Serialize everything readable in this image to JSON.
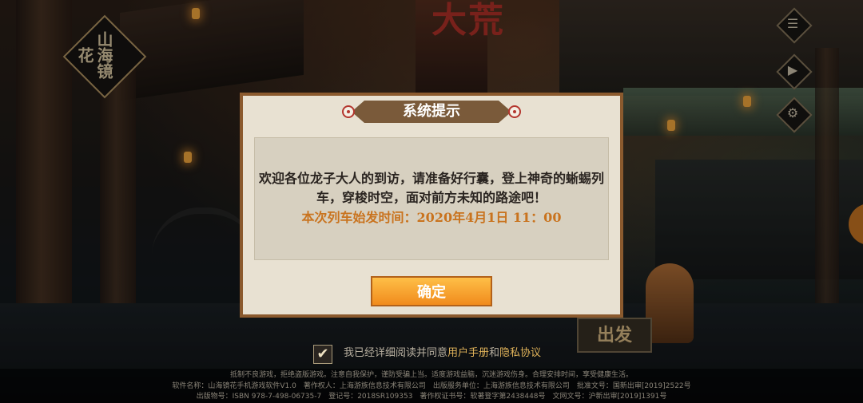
{
  "logo": {
    "text": "山海镜花"
  },
  "background": {
    "sign_text": "大荒",
    "depart_sign": "出发"
  },
  "side_menu": [
    {
      "icon": "document-icon",
      "glyph": "☰"
    },
    {
      "icon": "video-icon",
      "glyph": "▶"
    },
    {
      "icon": "settings-icon",
      "glyph": "⚙"
    }
  ],
  "dialog": {
    "title": "系统提示",
    "message": "欢迎各位龙子大人的到访，请准备好行囊，登上神奇的蜥蜴列车，穿梭时空，面对前方未知的路途吧！",
    "time_notice": "本次列车始发时间：2020年4月1日 11：00",
    "confirm_label": "确定"
  },
  "agreement": {
    "checked": true,
    "check_glyph": "✔",
    "prefix": "我已经详细阅读并同意",
    "user_manual": "用户手册",
    "and": "和",
    "privacy": "隐私协议"
  },
  "footer": {
    "line1": "抵制不良游戏，拒绝盗版游戏。注意自我保护，谨防受骗上当。适度游戏益脑，沉迷游戏伤身。合理安排时间，享受健康生活。",
    "line2": "软件名称：山海镜花手机游戏软件V1.0　著作权人：上海游族信息技术有限公司　出版服务单位：上海游族信息技术有限公司　批准文号：国新出审[2019]2522号",
    "line3": "出版物号：ISBN 978-7-498-06735-7　登记号：2018SR109353　著作权证书号：软著登字第2438448号　文网文号：沪新出审[2019]1391号"
  },
  "colors": {
    "dialog_border": "#8b5a2e",
    "accent_orange": "#c9731e",
    "button_gradient_top": "#ffc24a",
    "button_gradient_bottom": "#f0881a"
  }
}
